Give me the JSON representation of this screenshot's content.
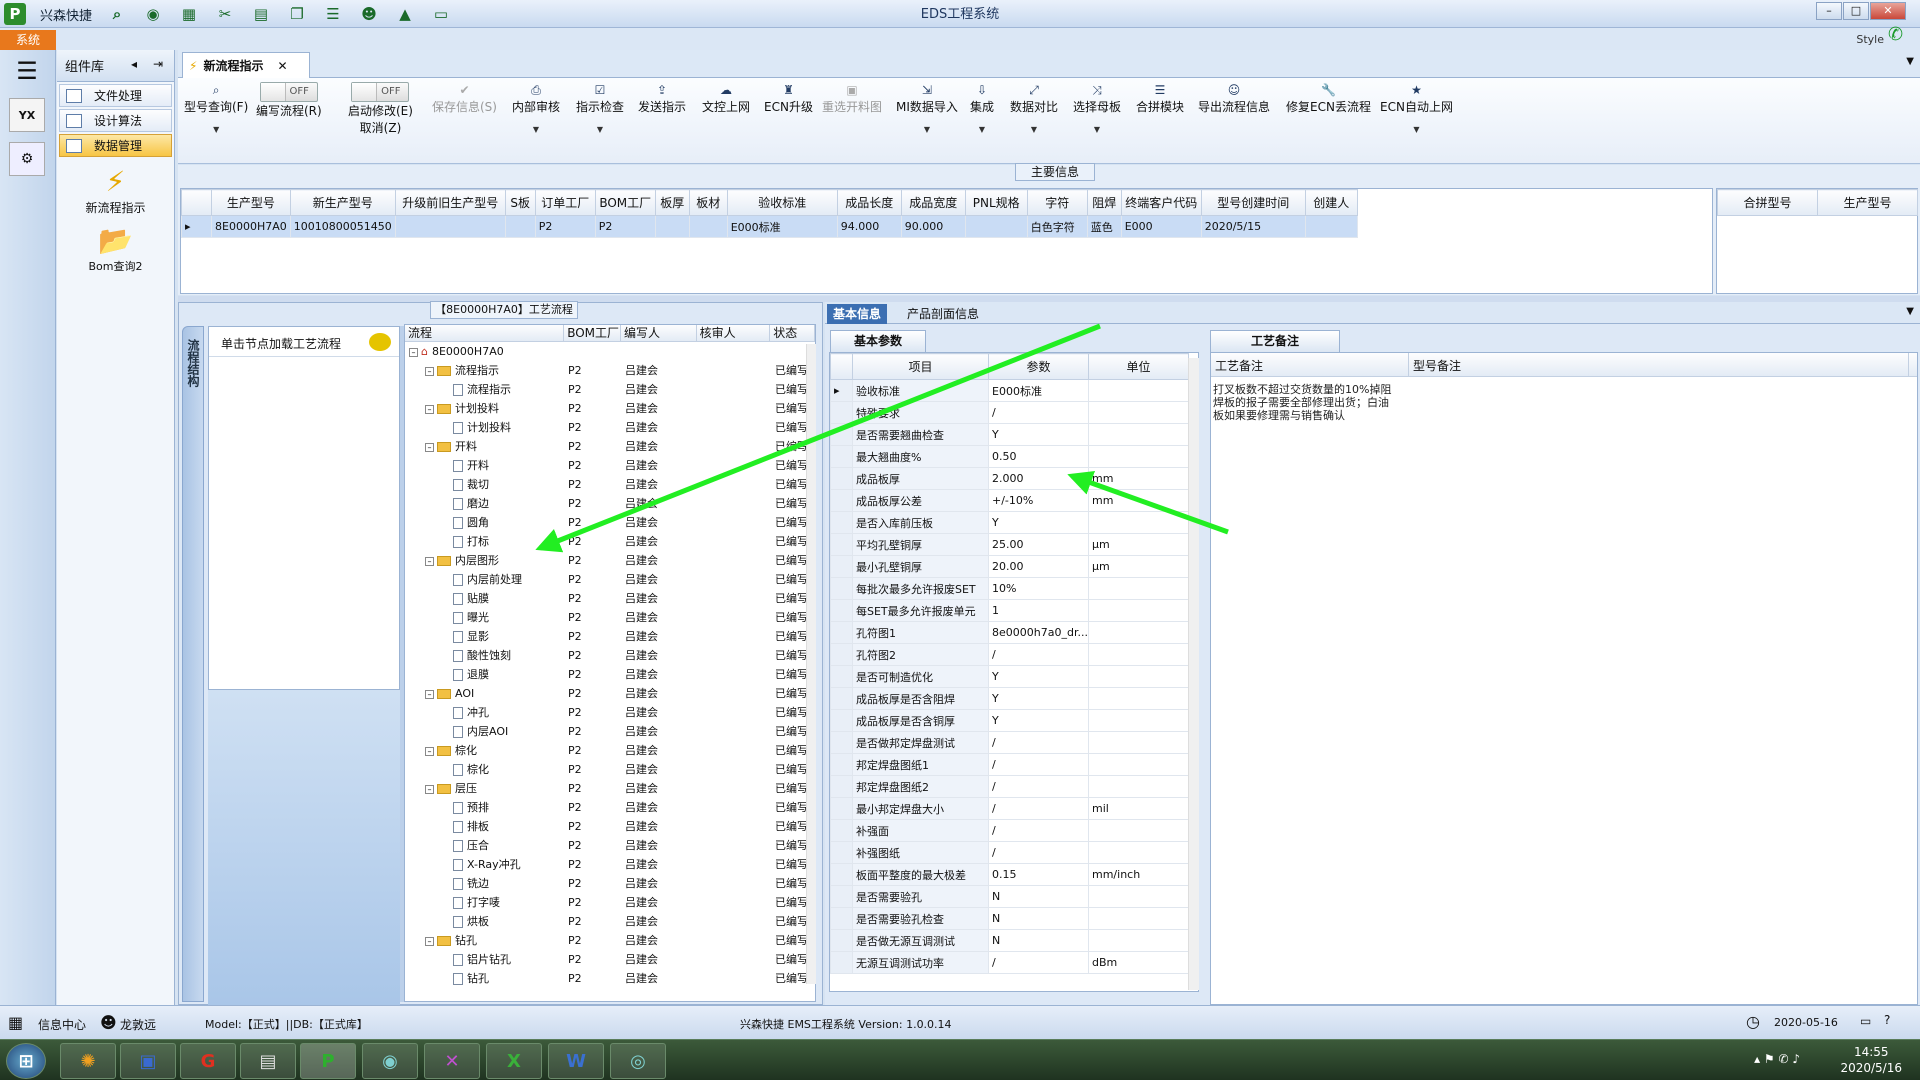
{
  "titlebar": {
    "app_name": "兴森快捷",
    "window_title": "EDS工程系统"
  },
  "ribbon": {
    "system_tab": "系统",
    "style_label": "Style"
  },
  "component_lib": {
    "title": "组件库",
    "items": [
      {
        "label": "文件处理"
      },
      {
        "label": "设计算法"
      },
      {
        "label": "数据管理"
      }
    ],
    "big_buttons": [
      {
        "label": "新流程指示"
      },
      {
        "label": "Bom查询2"
      }
    ]
  },
  "doc_tab": {
    "label": "新流程指示"
  },
  "toolbar": {
    "buttons": [
      {
        "label": "型号查询(F)"
      },
      {
        "label": "编写流程(R)",
        "toggle": "OFF"
      },
      {
        "label": "启动修改(E)",
        "label2": "取消(Z)",
        "toggle": "OFF"
      },
      {
        "label": "保存信息(S)"
      },
      {
        "label": "内部审核"
      },
      {
        "label": "指示检查"
      },
      {
        "label": "发送指示"
      },
      {
        "label": "文控上网"
      },
      {
        "label": "ECN升级"
      },
      {
        "label": "重选开料图"
      },
      {
        "label": "MI数据导入"
      },
      {
        "label": "集成"
      },
      {
        "label": "数据对比"
      },
      {
        "label": "选择母板"
      },
      {
        "label": "合拼模块"
      },
      {
        "label": "导出流程信息"
      },
      {
        "label": "修复ECN丢流程"
      },
      {
        "label": "ECN自动上网"
      }
    ]
  },
  "main_info": {
    "title": "主要信息",
    "columns": [
      "生产型号",
      "新生产型号",
      "升级前旧生产型号",
      "S板",
      "订单工厂",
      "BOM工厂",
      "板厚",
      "板材",
      "验收标准",
      "成品长度",
      "成品宽度",
      "PNL规格",
      "字符",
      "阻焊",
      "终端客户代码",
      "型号创建时间",
      "创建人"
    ],
    "rows": [
      [
        "8E0000H7A0",
        "10010800051450",
        "",
        "",
        "P2",
        "P2",
        "",
        "",
        "E000标准",
        "94.000",
        "90.000",
        "",
        "白色字符",
        "蓝色",
        "E000",
        "2020/5/15",
        ""
      ]
    ],
    "merge_columns": [
      "合拼型号",
      "生产型号"
    ]
  },
  "flow": {
    "title": "【8E0000H7A0】工艺流程",
    "vertical_tab": "流程结构",
    "hint": "单击节点加载工艺流程",
    "columns": [
      "流程",
      "BOM工厂",
      "编写人",
      "核审人",
      "状态"
    ],
    "rows": [
      {
        "level": 0,
        "type": "root",
        "name": "8E0000H7A0",
        "bom": "",
        "writer": "",
        "status": ""
      },
      {
        "level": 1,
        "type": "folder",
        "name": "流程指示",
        "bom": "P2",
        "writer": "吕建会",
        "status": "已编写"
      },
      {
        "level": 2,
        "type": "doc",
        "name": "流程指示",
        "bom": "P2",
        "writer": "吕建会",
        "status": "已编写"
      },
      {
        "level": 1,
        "type": "folder",
        "name": "计划投料",
        "bom": "P2",
        "writer": "吕建会",
        "status": "已编写"
      },
      {
        "level": 2,
        "type": "doc",
        "name": "计划投料",
        "bom": "P2",
        "writer": "吕建会",
        "status": "已编写"
      },
      {
        "level": 1,
        "type": "folder",
        "name": "开料",
        "bom": "P2",
        "writer": "吕建会",
        "status": "已编写"
      },
      {
        "level": 2,
        "type": "doc",
        "name": "开料",
        "bom": "P2",
        "writer": "吕建会",
        "status": "已编写"
      },
      {
        "level": 2,
        "type": "doc",
        "name": "裁切",
        "bom": "P2",
        "writer": "吕建会",
        "status": "已编写"
      },
      {
        "level": 2,
        "type": "doc",
        "name": "磨边",
        "bom": "P2",
        "writer": "吕建会",
        "status": "已编写"
      },
      {
        "level": 2,
        "type": "doc",
        "name": "圆角",
        "bom": "P2",
        "writer": "吕建会",
        "status": "已编写"
      },
      {
        "level": 2,
        "type": "doc",
        "name": "打标",
        "bom": "P2",
        "writer": "吕建会",
        "status": "已编写"
      },
      {
        "level": 1,
        "type": "folder",
        "name": "内层图形",
        "bom": "P2",
        "writer": "吕建会",
        "status": "已编写"
      },
      {
        "level": 2,
        "type": "doc",
        "name": "内层前处理",
        "bom": "P2",
        "writer": "吕建会",
        "status": "已编写"
      },
      {
        "level": 2,
        "type": "doc",
        "name": "贴膜",
        "bom": "P2",
        "writer": "吕建会",
        "status": "已编写"
      },
      {
        "level": 2,
        "type": "doc",
        "name": "曝光",
        "bom": "P2",
        "writer": "吕建会",
        "status": "已编写"
      },
      {
        "level": 2,
        "type": "doc",
        "name": "显影",
        "bom": "P2",
        "writer": "吕建会",
        "status": "已编写"
      },
      {
        "level": 2,
        "type": "doc",
        "name": "酸性蚀刻",
        "bom": "P2",
        "writer": "吕建会",
        "status": "已编写"
      },
      {
        "level": 2,
        "type": "doc",
        "name": "退膜",
        "bom": "P2",
        "writer": "吕建会",
        "status": "已编写"
      },
      {
        "level": 1,
        "type": "folder",
        "name": "AOI",
        "bom": "P2",
        "writer": "吕建会",
        "status": "已编写"
      },
      {
        "level": 2,
        "type": "doc",
        "name": "冲孔",
        "bom": "P2",
        "writer": "吕建会",
        "status": "已编写"
      },
      {
        "level": 2,
        "type": "doc",
        "name": "内层AOI",
        "bom": "P2",
        "writer": "吕建会",
        "status": "已编写"
      },
      {
        "level": 1,
        "type": "folder",
        "name": "棕化",
        "bom": "P2",
        "writer": "吕建会",
        "status": "已编写"
      },
      {
        "level": 2,
        "type": "doc",
        "name": "棕化",
        "bom": "P2",
        "writer": "吕建会",
        "status": "已编写"
      },
      {
        "level": 1,
        "type": "folder",
        "name": "层压",
        "bom": "P2",
        "writer": "吕建会",
        "status": "已编写"
      },
      {
        "level": 2,
        "type": "doc",
        "name": "预排",
        "bom": "P2",
        "writer": "吕建会",
        "status": "已编写"
      },
      {
        "level": 2,
        "type": "doc",
        "name": "排板",
        "bom": "P2",
        "writer": "吕建会",
        "status": "已编写"
      },
      {
        "level": 2,
        "type": "doc",
        "name": "压合",
        "bom": "P2",
        "writer": "吕建会",
        "status": "已编写"
      },
      {
        "level": 2,
        "type": "doc",
        "name": "X-Ray冲孔",
        "bom": "P2",
        "writer": "吕建会",
        "status": "已编写"
      },
      {
        "level": 2,
        "type": "doc",
        "name": "铣边",
        "bom": "P2",
        "writer": "吕建会",
        "status": "已编写"
      },
      {
        "level": 2,
        "type": "doc",
        "name": "打字唛",
        "bom": "P2",
        "writer": "吕建会",
        "status": "已编写"
      },
      {
        "level": 2,
        "type": "doc",
        "name": "烘板",
        "bom": "P2",
        "writer": "吕建会",
        "status": "已编写"
      },
      {
        "level": 1,
        "type": "folder",
        "name": "钻孔",
        "bom": "P2",
        "writer": "吕建会",
        "status": "已编写"
      },
      {
        "level": 2,
        "type": "doc",
        "name": "铝片钻孔",
        "bom": "P2",
        "writer": "吕建会",
        "status": "已编写"
      },
      {
        "level": 2,
        "type": "doc",
        "name": "钻孔",
        "bom": "P2",
        "writer": "吕建会",
        "status": "已编写"
      }
    ]
  },
  "right": {
    "tabs": [
      "基本信息",
      "产品剖面信息"
    ],
    "sub_tab": "基本参数",
    "param_columns": [
      "项目",
      "参数",
      "单位"
    ],
    "params": [
      [
        "验收标准",
        "E000标准",
        ""
      ],
      [
        "特殊要求",
        "/",
        ""
      ],
      [
        "是否需要翘曲检查",
        "Y",
        ""
      ],
      [
        "最大翘曲度%",
        "0.50",
        ""
      ],
      [
        "成品板厚",
        "2.000",
        "mm"
      ],
      [
        "成品板厚公差",
        "+/-10%",
        "mm"
      ],
      [
        "是否入库前压板",
        "Y",
        ""
      ],
      [
        "平均孔壁铜厚",
        "25.00",
        "μm"
      ],
      [
        "最小孔壁铜厚",
        "20.00",
        "μm"
      ],
      [
        "每批次最多允许报废SET",
        "10%",
        ""
      ],
      [
        "每SET最多允许报废单元",
        "1",
        ""
      ],
      [
        "孔符图1",
        "8e0000h7a0_dr...",
        ""
      ],
      [
        "孔符图2",
        "/",
        ""
      ],
      [
        "是否可制造优化",
        "Y",
        ""
      ],
      [
        "成品板厚是否含阻焊",
        "Y",
        ""
      ],
      [
        "成品板厚是否含铜厚",
        "Y",
        ""
      ],
      [
        "是否做邦定焊盘测试",
        "/",
        ""
      ],
      [
        "邦定焊盘图纸1",
        "/",
        ""
      ],
      [
        "邦定焊盘图纸2",
        "/",
        ""
      ],
      [
        "最小邦定焊盘大小",
        "/",
        "mil"
      ],
      [
        "补强面",
        "/",
        ""
      ],
      [
        "补强图纸",
        "/",
        ""
      ],
      [
        "板面平整度的最大极差",
        "0.15",
        "mm/inch"
      ],
      [
        "是否需要验孔",
        "N",
        ""
      ],
      [
        "是否需要验孔检查",
        "N",
        ""
      ],
      [
        "是否做无源互调测试",
        "N",
        ""
      ],
      [
        "无源互调测试功率",
        "/",
        "dBm"
      ]
    ],
    "craft_tab": "工艺备注",
    "craft_columns": [
      "工艺备注",
      "型号备注"
    ],
    "craft_note": "打叉板数不超过交货数量的10%掉阻焊板的报子需要全部修理出货；白油板如果要修理需与销售确认"
  },
  "statusbar": {
    "info_center": "信息中心",
    "user": "龙敦远",
    "model_db": "Model:【正式】||DB:【正式库】",
    "version": "兴森快捷 EMS工程系统 Version: 1.0.0.14",
    "date": "2020-05-16"
  },
  "taskbar": {
    "time": "14:55",
    "date": "2020/5/16"
  },
  "colors": {
    "accent": "#3c6fb2",
    "selection": "#c9dcf5",
    "arrow": "#22ee22",
    "system_tab": "#e8781c"
  }
}
